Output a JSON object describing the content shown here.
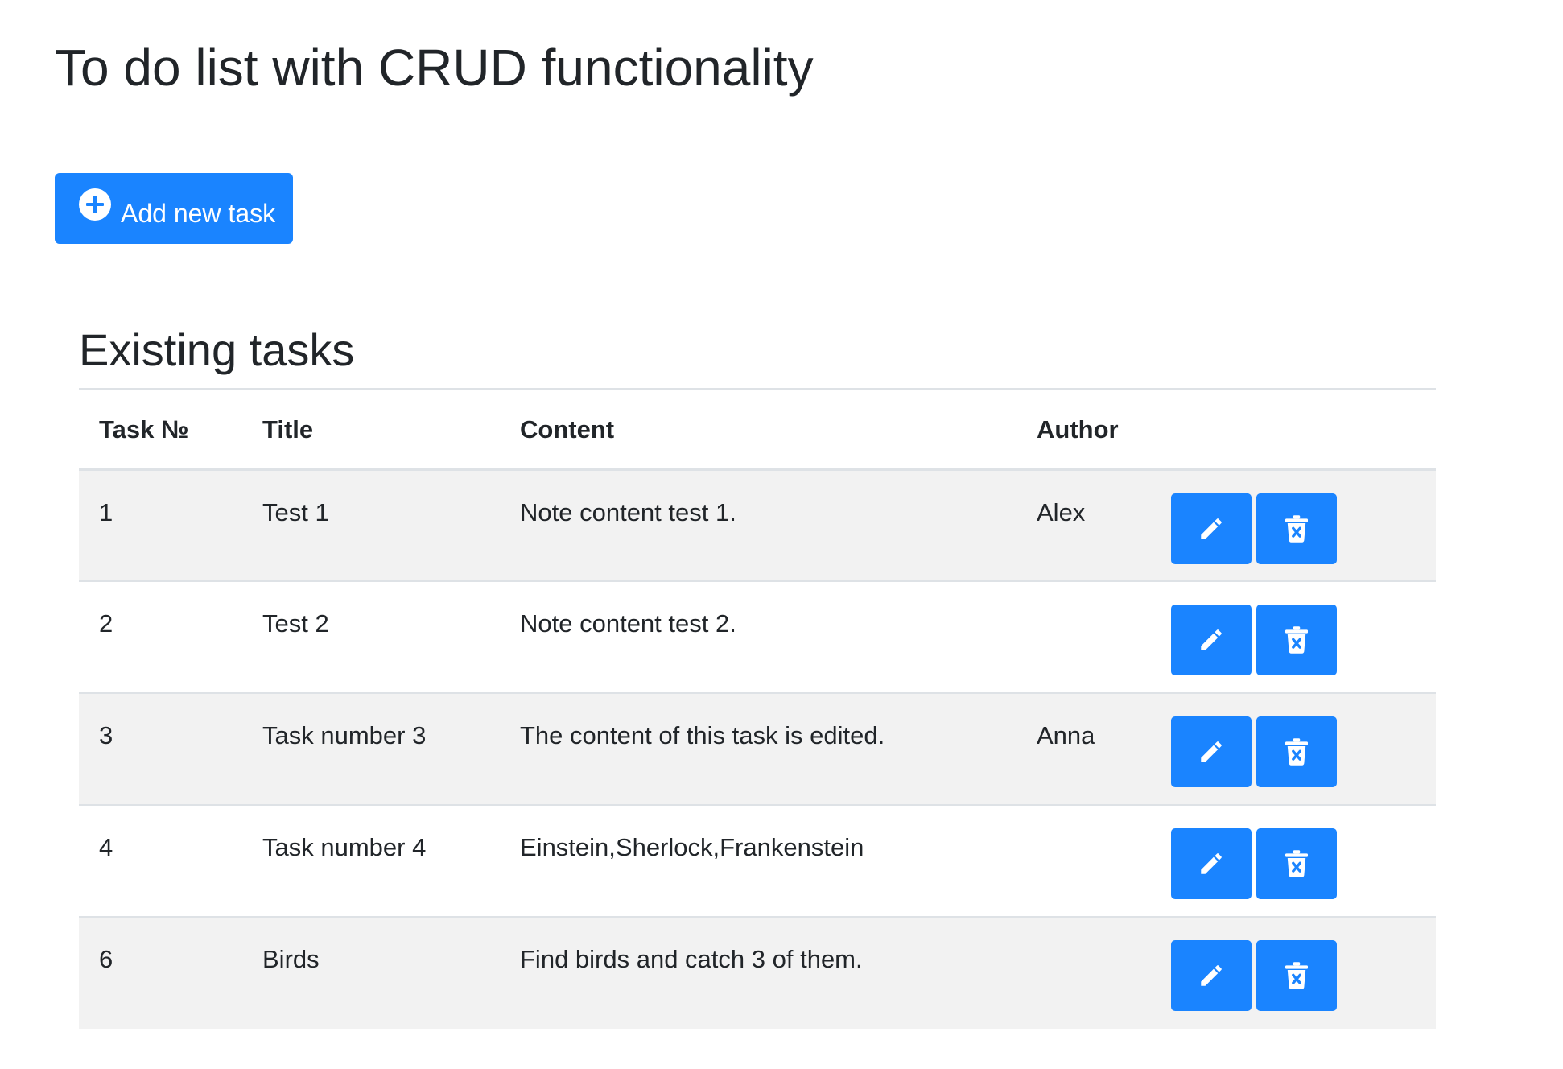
{
  "page": {
    "title": "To do list with CRUD functionality"
  },
  "toolbar": {
    "add_label": "Add new task",
    "add_icon": "plus-circle-icon"
  },
  "tasks_section": {
    "title": "Existing tasks"
  },
  "table": {
    "headers": {
      "number": "Task №",
      "title": "Title",
      "content": "Content",
      "author": "Author"
    },
    "rows": [
      {
        "number": "1",
        "title": "Test 1",
        "content": "Note content test 1.",
        "author": "Alex"
      },
      {
        "number": "2",
        "title": "Test 2",
        "content": "Note content test 2.",
        "author": ""
      },
      {
        "number": "3",
        "title": "Task number 3",
        "content": "The content of this task is edited.",
        "author": "Anna"
      },
      {
        "number": "4",
        "title": "Task number 4",
        "content": "Einstein,Sherlock,Frankenstein",
        "author": ""
      },
      {
        "number": "6",
        "title": "Birds",
        "content": "Find birds and catch 3 of them.",
        "author": ""
      }
    ],
    "row_actions": {
      "edit_icon": "pencil-icon",
      "delete_icon": "trash-x-icon"
    }
  },
  "colors": {
    "accent": "#1a84ff",
    "striped_row": "#f2f2f2",
    "border": "#dee2e6",
    "text": "#212529"
  }
}
